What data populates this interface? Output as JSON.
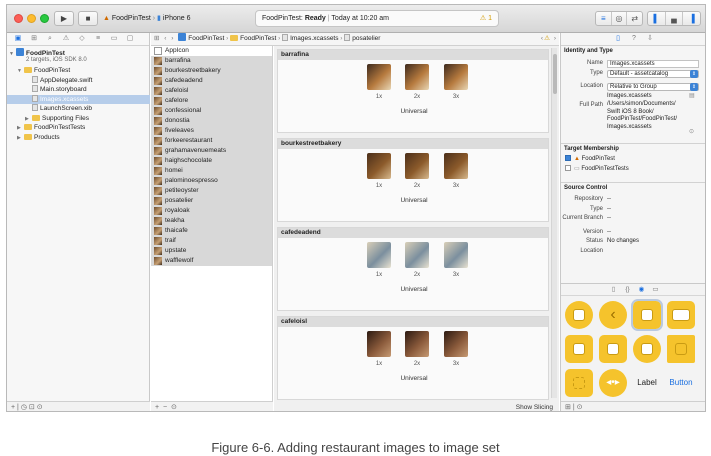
{
  "toolbar": {
    "scheme": "FoodPinTest",
    "device": "iPhone 6",
    "activity_app": "FoodPinTest:",
    "activity_status": "Ready",
    "activity_time": "Today at 10:20 am",
    "warning_count": "1"
  },
  "navigator": {
    "project_name": "FoodPinTest",
    "project_sub": "2 targets, iOS SDK 8.0",
    "items": [
      {
        "label": "FoodPinTest",
        "kind": "folder",
        "indent": 1,
        "open": true
      },
      {
        "label": "AppDelegate.swift",
        "kind": "file",
        "indent": 2
      },
      {
        "label": "Main.storyboard",
        "kind": "file",
        "indent": 2
      },
      {
        "label": "Images.xcassets",
        "kind": "file",
        "indent": 2,
        "selected": true
      },
      {
        "label": "LaunchScreen.xib",
        "kind": "file",
        "indent": 2
      },
      {
        "label": "Supporting Files",
        "kind": "folder",
        "indent": 2
      },
      {
        "label": "FoodPinTestTests",
        "kind": "folder",
        "indent": 1
      },
      {
        "label": "Products",
        "kind": "folder",
        "indent": 1
      }
    ]
  },
  "jumpbar": {
    "crumbs": [
      "FoodPinTest",
      "FoodPinTest",
      "Images.xcassets",
      "posatelier"
    ]
  },
  "assets": [
    "AppIcon",
    "barrafina",
    "bourkestreetbakery",
    "cafedeadend",
    "cafeloisl",
    "cafelore",
    "confessional",
    "donostia",
    "fiveleaves",
    "forkeerestaurant",
    "grahamavenuemeats",
    "haighschocolate",
    "homei",
    "palominoespresso",
    "petiteoyster",
    "posatelier",
    "royaloak",
    "teakha",
    "thaicafe",
    "traif",
    "upstate",
    "wafflewolf"
  ],
  "editor": {
    "sets": [
      {
        "name": "barrafina",
        "tone": [
          "#3d2a1e",
          "#b67a3e",
          "#e8d6b5"
        ]
      },
      {
        "name": "bourkestreetbakery",
        "tone": [
          "#4b2f1a",
          "#8c5b2b",
          "#d7b98e"
        ]
      },
      {
        "name": "cafedeadend",
        "tone": [
          "#d9cfb8",
          "#7b8f9e",
          "#e9e3d2"
        ]
      },
      {
        "name": "cafeloisl",
        "tone": [
          "#2c1a12",
          "#8a5a3b",
          "#c69a73"
        ]
      }
    ],
    "scales": [
      "1x",
      "2x",
      "3x"
    ],
    "universal_label": "Universal",
    "show_slicing": "Show Slicing"
  },
  "inspector": {
    "identity_title": "Identity and Type",
    "name_label": "Name",
    "name_value": "Images.xcassets",
    "type_label": "Type",
    "type_value": "Default - assetcatalog",
    "location_label": "Location",
    "location_value": "Relative to Group",
    "location_file": "Images.xcassets",
    "fullpath_label": "Full Path",
    "fullpath_lines": [
      "/Users/simon/Documents/",
      "Swift iOS 8 Book/",
      "FoodPinTest/FoodPinTest/",
      "Images.xcassets"
    ],
    "target_title": "Target Membership",
    "targets": [
      {
        "name": "FoodPinTest",
        "checked": true
      },
      {
        "name": "FoodPinTestTests",
        "checked": false
      }
    ],
    "source_title": "Source Control",
    "repository_label": "Repository",
    "repository_value": "--",
    "sc_type_label": "Type",
    "sc_type_value": "--",
    "branch_label": "Current Branch",
    "branch_value": "--",
    "version_label": "Version",
    "version_value": "--",
    "status_label": "Status",
    "status_value": "No changes",
    "sc_location_label": "Location",
    "sc_location_value": ""
  },
  "library": {
    "label_text": "Label",
    "button_text": "Button"
  },
  "caption": "Figure 6-6. Adding restaurant images to image set",
  "colors": {
    "accent": "#1a6fe0",
    "selection": "#b6cdea",
    "library_yellow": "#f5c32c"
  }
}
